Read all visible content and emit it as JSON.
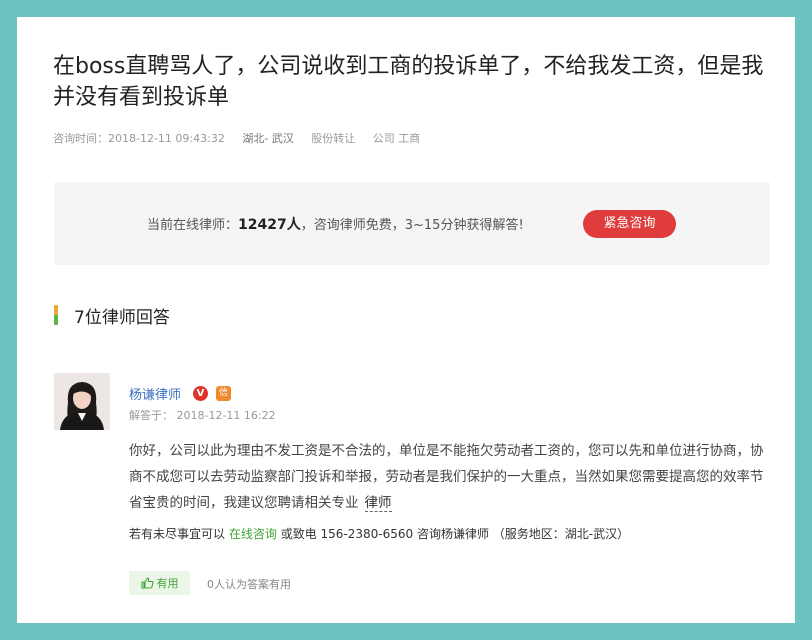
{
  "question": {
    "title": "在boss直聘骂人了，公司说收到工商的投诉单了，不给我发工资，但是我并没有看到投诉单",
    "time_label": "咨询时间：",
    "time_value": "2018-12-11 09:43:32",
    "location": "湖北- 武汉",
    "tags": [
      "股份转让",
      "公司 工商"
    ]
  },
  "banner": {
    "prefix": "当前在线律师：",
    "count": "12427人",
    "suffix": "，咨询律师免费，3~15分钟获得解答!",
    "button_label": "紧急咨询"
  },
  "answers_section": {
    "title": "7位律师回答"
  },
  "answer": {
    "lawyer_name": "杨谦律师",
    "badge_v": "V",
    "badge_xin": "信",
    "answered_label": "解答于：",
    "answered_time": "2018-12-11 16:22",
    "body": "你好，公司以此为理由不发工资是不合法的，单位是不能拖欠劳动者工资的，您可以先和单位进行协商，协商不成您可以去劳动监察部门投诉和举报，劳动者是我们保护的一大重点，当然如果您需要提高您的效率节省宝贵的时间，我建议您聘请相关专业",
    "body_keyword": "律师",
    "contact_prefix": "若有未尽事宜可以",
    "contact_link": "在线咨询",
    "contact_middle": "或致电 156-2380-6560 咨询杨谦律师 （服务地区：湖北-武汉）",
    "useful_label": "有用",
    "useful_count": "0人认为答案有用"
  },
  "colors": {
    "page_bg": "#6cc3c0",
    "accent_red": "#e03c3c",
    "link_blue": "#3a6fc1",
    "green": "#3fa535"
  },
  "icons": [
    "v-badge-icon",
    "xin-badge-icon",
    "thumbs-up-icon"
  ]
}
